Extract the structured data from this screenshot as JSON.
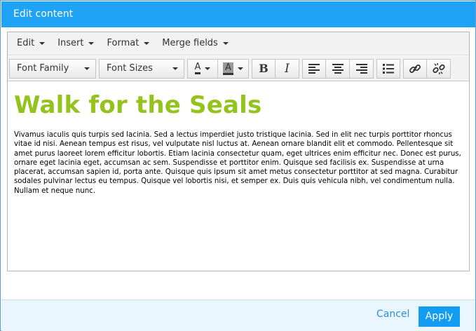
{
  "dialog": {
    "title": "Edit content"
  },
  "menubar": {
    "items": [
      {
        "label": "Edit"
      },
      {
        "label": "Insert"
      },
      {
        "label": "Format"
      },
      {
        "label": "Merge fields"
      }
    ]
  },
  "toolbar": {
    "font_family": "Font Family",
    "font_sizes": "Font Sizes",
    "text_color_letter": "A",
    "bg_color_letter": "A",
    "bold_letter": "B",
    "italic_letter": "I"
  },
  "content": {
    "heading": "Walk for the Seals",
    "heading_color": "#95c31e",
    "paragraph": "Vivamus iaculis quis turpis sed lacinia. Sed a lectus imperdiet justo tristique lacinia. Sed in elit nec turpis porttitor rhoncus vitae id nisi. Aenean tempus est risus, vel vulputate nisl luctus at. Aenean ornare blandit elit et commodo. Pellentesque sit amet purus laoreet lorem efficitur lobortis. Etiam lacinia consectetur quam, eget ultrices enim efficitur nec. Donec est purus, ornare eget lacinia eget, accumsan ac sem. Suspendisse et porttitor enim. Quisque sed facilisis ex. Suspendisse at urna placerat, accumsan sapien id, porta ante. Quisque quis ipsum sit amet metus consectetur porttitor at sed magna. Curabitur sodales pulvinar lectus eu tempus. Quisque vel lobortis nisi, et semper ex. Duis quis vehicula nibh, vel condimentum nulla. Nullam et neque nunc."
  },
  "footer": {
    "cancel_label": "Cancel",
    "apply_label": "Apply"
  },
  "colors": {
    "title_bar": "#1ea3f5",
    "apply_button": "#139df2",
    "link": "#2f8fd8"
  }
}
